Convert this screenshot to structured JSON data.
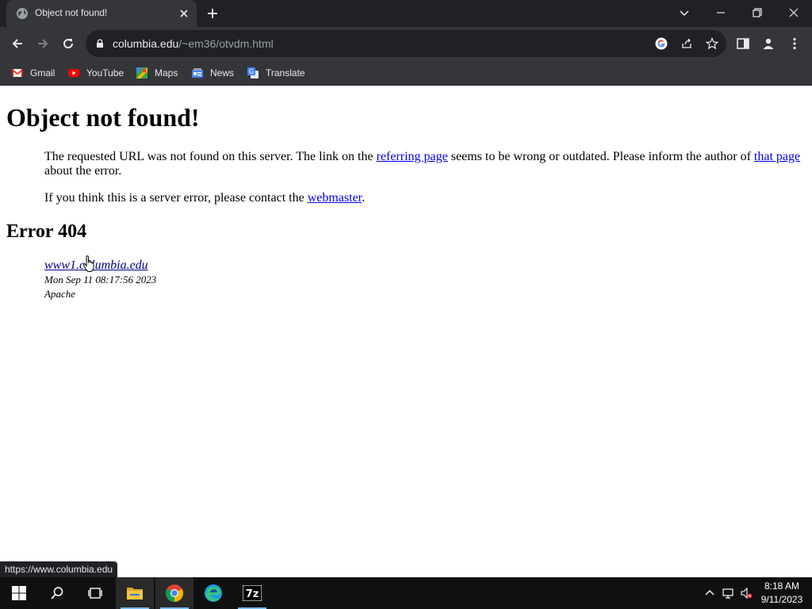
{
  "window": {
    "tab_title": "Object not found!"
  },
  "toolbar": {
    "url_host": "columbia.edu",
    "url_path": "/~em36/otvdm.html"
  },
  "bookmarks": [
    {
      "label": "Gmail",
      "icon": "gmail-icon"
    },
    {
      "label": "YouTube",
      "icon": "youtube-icon"
    },
    {
      "label": "Maps",
      "icon": "maps-icon"
    },
    {
      "label": "News",
      "icon": "news-icon"
    },
    {
      "label": "Translate",
      "icon": "translate-icon"
    }
  ],
  "page": {
    "heading": "Object not found!",
    "para1_pre": "The requested URL was not found on this server. The link on the ",
    "para1_link1": "referring page",
    "para1_mid": " seems to be wrong or outdated. Please inform the author of ",
    "para1_link2": "that page",
    "para1_post": " about the error.",
    "para2_pre": "If you think this is a server error, please contact the ",
    "para2_link": "webmaster",
    "para2_post": ".",
    "error_heading": "Error 404",
    "address_link": "www1.columbia.edu",
    "address_date": "Mon Sep 11 08:17:56 2023",
    "address_server": "Apache"
  },
  "status_bar": {
    "hover_url": "https://www.columbia.edu"
  },
  "taskbar": {
    "items": [
      "start-icon",
      "search-icon",
      "task-view-icon",
      "file-explorer-icon",
      "chrome-icon",
      "edge-icon",
      "7zip-icon"
    ],
    "time": "8:18 AM",
    "date": "9/11/2023"
  },
  "colors": {
    "chrome_dark": "#202124",
    "chrome_toolbar": "#35363a",
    "link": "#0000ee",
    "taskbar": "#101010"
  }
}
